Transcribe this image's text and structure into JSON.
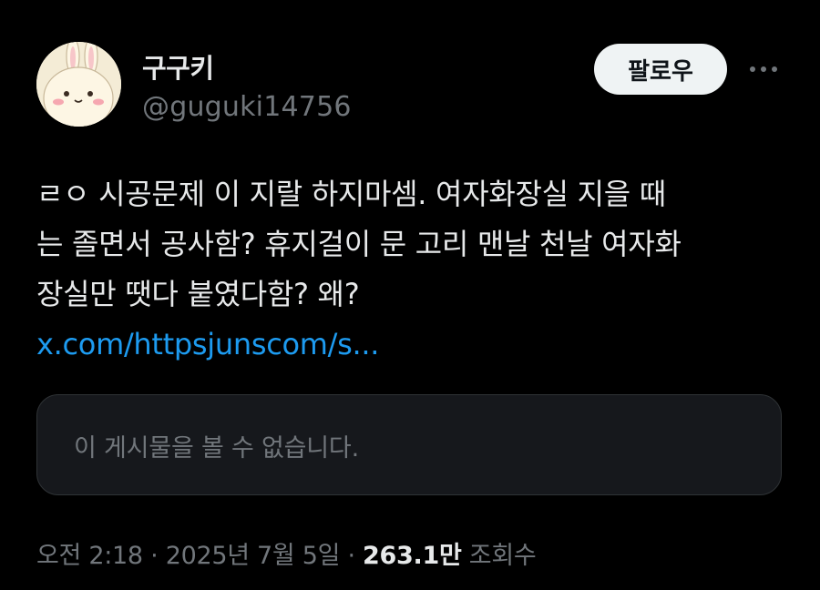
{
  "author": {
    "display_name": "구구키",
    "handle": "@guguki14756",
    "avatar_icon": "bunny-avatar-icon"
  },
  "follow_button": {
    "label": "팔로우"
  },
  "more_button": {
    "icon": "more-horizontal-icon",
    "symbol": "···"
  },
  "tweet": {
    "lines": [
      "ㄹㅇ 시공문제 이 지랄 하지마셈. 여자화장실 지을 때",
      "는 졸면서 공사함? 휴지걸이 문 고리 맨날 천날 여자화",
      "장실만 땟다 붙였다함? 왜?"
    ],
    "link": "x.com/httpsjunscom/s..."
  },
  "quoted_post": {
    "unavailable_text": "이 게시물을 볼 수 없습니다."
  },
  "meta": {
    "time": "오전 2:18",
    "separator": "·",
    "date": "2025년 7월 5일",
    "views_count": "263.1만",
    "views_label": "조회수"
  },
  "colors": {
    "background": "#000000",
    "primary_text": "#e7e9ea",
    "secondary_text": "#71767b",
    "link": "#1d9bf0",
    "follow_button_bg": "#eff3f4",
    "card_bg": "#16181c",
    "card_border": "#2f3336"
  }
}
